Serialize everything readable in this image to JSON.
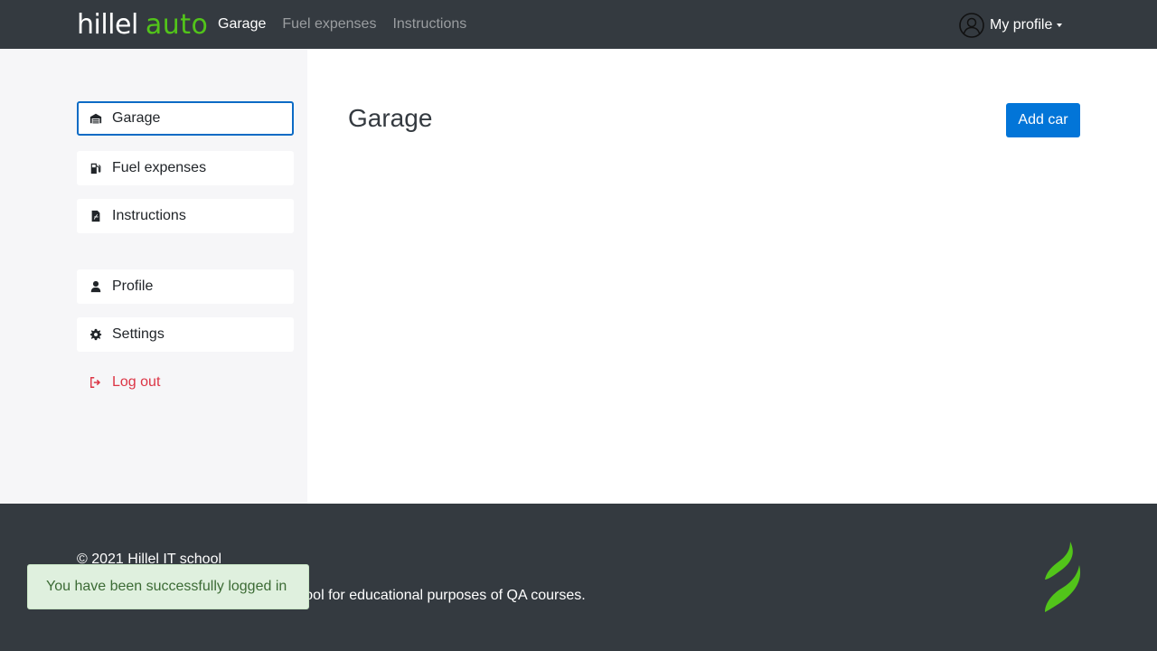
{
  "header": {
    "logo": {
      "primary": "hillel",
      "secondary": "auto"
    },
    "nav": [
      {
        "label": "Garage",
        "active": true
      },
      {
        "label": "Fuel expenses",
        "active": false
      },
      {
        "label": "Instructions",
        "active": false
      }
    ],
    "profile": {
      "label": "My profile",
      "icon": "user-circle-icon"
    }
  },
  "sidebar": {
    "items": [
      {
        "label": "Garage",
        "icon": "garage-icon",
        "active": true
      },
      {
        "label": "Fuel expenses",
        "icon": "fuel-pump-icon",
        "active": false
      },
      {
        "label": "Instructions",
        "icon": "pdf-file-icon",
        "active": false
      },
      {
        "label": "Profile",
        "icon": "user-icon",
        "active": false
      },
      {
        "label": "Settings",
        "icon": "gear-icon",
        "active": false
      },
      {
        "label": "Log out",
        "icon": "logout-icon",
        "active": false
      }
    ]
  },
  "main": {
    "title": "Garage",
    "add_car_label": "Add car"
  },
  "footer": {
    "copyright": "© 2021 Hillel IT school",
    "description": "Hillel auto developed in Hillel IT school for educational purposes of QA courses."
  },
  "toast": {
    "message": "You have been successfully logged in"
  },
  "colors": {
    "header_bg": "#343a40",
    "accent_green": "#52c41a",
    "primary_blue": "#0275d8",
    "active_border": "#0c6bc5",
    "logout_red": "#dc3545",
    "toast_bg": "#dff0de",
    "toast_text": "#3c6b35"
  }
}
